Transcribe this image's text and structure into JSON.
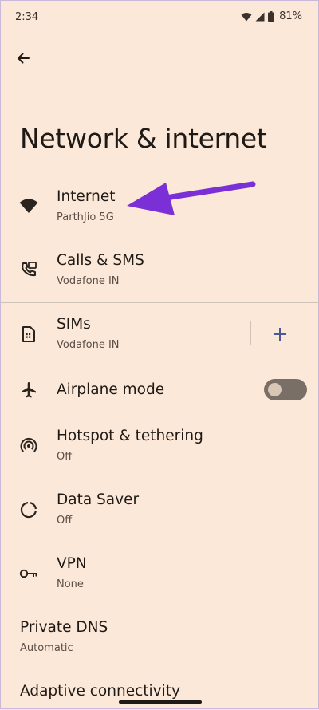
{
  "status": {
    "time": "2:34",
    "battery": "81%"
  },
  "header": {
    "title": "Network & internet"
  },
  "items": {
    "internet": {
      "title": "Internet",
      "subtitle": "ParthJio 5G"
    },
    "calls": {
      "title": "Calls & SMS",
      "subtitle": "Vodafone IN"
    },
    "sims": {
      "title": "SIMs",
      "subtitle": "Vodafone IN"
    },
    "airplane": {
      "title": "Airplane mode",
      "enabled": false
    },
    "hotspot": {
      "title": "Hotspot & tethering",
      "subtitle": "Off"
    },
    "data_saver": {
      "title": "Data Saver",
      "subtitle": "Off"
    },
    "vpn": {
      "title": "VPN",
      "subtitle": "None"
    },
    "private_dns": {
      "title": "Private DNS",
      "subtitle": "Automatic"
    },
    "adaptive": {
      "title": "Adaptive connectivity"
    }
  },
  "colors": {
    "background": "#fce8d8",
    "text": "#1f1a16",
    "annotation_arrow": "#7b2fd6",
    "accent": "#4a5a99"
  }
}
